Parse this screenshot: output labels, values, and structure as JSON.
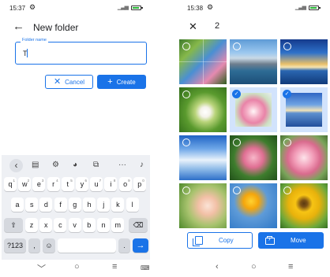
{
  "left": {
    "status": {
      "time": "15:37"
    },
    "appbar": {
      "back_icon": "arrow-back-icon",
      "title": "New folder"
    },
    "field": {
      "legend": "Folder name",
      "value": "T"
    },
    "buttons": {
      "cancel": "Cancel",
      "create": "Create"
    },
    "keyboard": {
      "row1": [
        {
          "k": "q",
          "n": "1"
        },
        {
          "k": "w",
          "n": "2"
        },
        {
          "k": "e",
          "n": "3"
        },
        {
          "k": "r",
          "n": "4"
        },
        {
          "k": "t",
          "n": "5"
        },
        {
          "k": "y",
          "n": "6"
        },
        {
          "k": "u",
          "n": "7"
        },
        {
          "k": "i",
          "n": "8"
        },
        {
          "k": "o",
          "n": "9"
        },
        {
          "k": "p",
          "n": "0"
        }
      ],
      "row2": [
        "a",
        "s",
        "d",
        "f",
        "g",
        "h",
        "j",
        "k",
        "l"
      ],
      "row3": [
        "z",
        "x",
        "c",
        "v",
        "b",
        "n",
        "m"
      ],
      "symbols_key": "?123",
      "comma_key": ",",
      "period_key": "."
    }
  },
  "right": {
    "status": {
      "time": "15:38"
    },
    "selection": {
      "count": "2"
    },
    "actions": {
      "copy": "Copy",
      "move": "Move"
    }
  },
  "colors": {
    "accent": "#1a73e8",
    "battery": "#27b635",
    "keyboard_bg": "#eef0f4"
  }
}
